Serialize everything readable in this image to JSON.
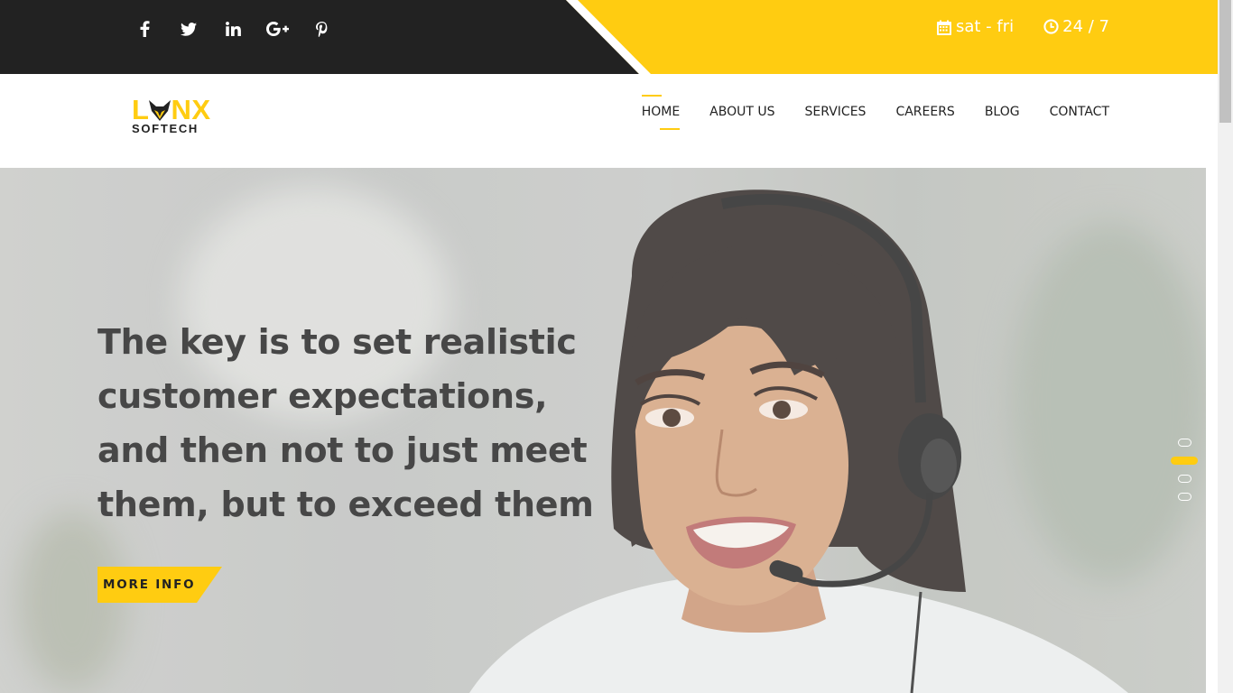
{
  "topbar": {
    "social": [
      {
        "icon": "facebook-icon",
        "name": "social-facebook"
      },
      {
        "icon": "twitter-icon",
        "name": "social-twitter"
      },
      {
        "icon": "linkedin-icon",
        "name": "social-linkedin"
      },
      {
        "icon": "google-plus-icon",
        "name": "social-google-plus"
      },
      {
        "icon": "pinterest-icon",
        "name": "social-pinterest"
      }
    ],
    "days_icon": "calendar-icon",
    "days": "sat - fri",
    "hours_icon": "clock-icon",
    "hours": "24 / 7"
  },
  "logo": {
    "text_before": "L",
    "text_after": "NX",
    "subtitle": "SOFTECH",
    "icon": "fox-head-icon"
  },
  "menu": {
    "items": [
      "HOME",
      "ABOUT US",
      "SERVICES",
      "CAREERS",
      "BLOG",
      "CONTACT"
    ],
    "active": "HOME"
  },
  "hero": {
    "headline": [
      "The key is to set realistic",
      "customer expectations,",
      "and then not to just meet",
      "them, but to exceed them"
    ],
    "button_label": "MORE INFO",
    "slides_total": 4,
    "active_slide": 2
  },
  "colors": {
    "accent": "#ffcc11",
    "dark": "#222222",
    "text": "#474747"
  }
}
